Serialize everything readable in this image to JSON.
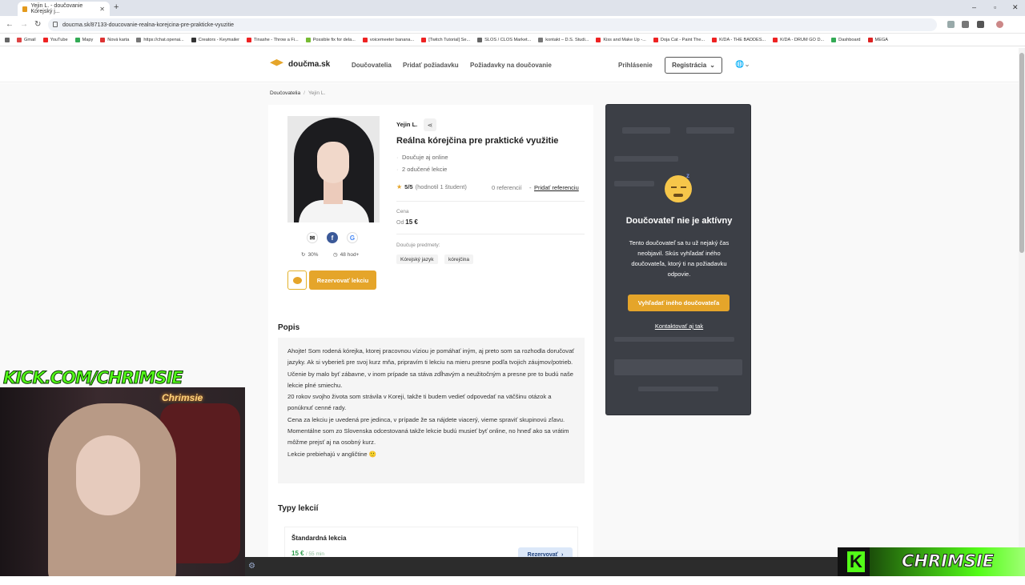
{
  "browser": {
    "tab_title": "Yejin L. - doučovanie Kórejský j...",
    "url": "doucma.sk/87133-doucovanie-realna-korejcina-pre-prakticke-vyuzitie",
    "bookmarks": [
      "Gmail",
      "YouTube",
      "Mapy",
      "Nová karta",
      "https://chat.openai...",
      "Creators - Keymailer",
      "Tinashe - Throw a Fi...",
      "Possible fix for dela...",
      "voicemeeter banana...",
      "[Twitch Tutorial] Se...",
      "SLOS / CLOS Market...",
      "kontakt – D.S. Studi...",
      "Kiss and Make Up -...",
      "Doja Cat - Paint The...",
      "K/DA - THE BADDES...",
      "K/DA - DRUM GO D...",
      "Dashboard",
      "MEGA"
    ]
  },
  "site": {
    "logo": "doučma.sk",
    "nav": [
      "Doučovatelia",
      "Pridať požiadavku",
      "Požiadavky na doučovanie"
    ],
    "login": "Prihlásenie",
    "register": "Registrácia",
    "register_caret": "⌄",
    "globe": "🌐⌄"
  },
  "breadcrumb": {
    "root": "Doučovatelia",
    "current": "Yejin L."
  },
  "tutor": {
    "name": "Yejin L.",
    "title": "Reálna kórejčina pre praktické využitie",
    "online": "Doučuje aj online",
    "taught": "2 odučené lekcie",
    "rating": "5/5",
    "rating_note": "(hodnotil 1 študent)",
    "refs": "0 referencií",
    "add_ref": "Pridať referenciu",
    "price_label": "Cena",
    "price_prefix": "Od",
    "price": "15 €",
    "subjects_label": "Doučuje predmety:",
    "subjects": [
      "Kórejský jazyk",
      "kórejčina"
    ],
    "response_rate": "30%",
    "response_time": "48 hod+",
    "book_label": "Rezervovať lekciu"
  },
  "description": {
    "title": "Popis",
    "paragraphs": [
      "Ahojte! Som rodená kórejka, ktorej pracovnou víziou je pomáhať iným, aj preto som sa rozhodla doručovať jazyky. Ak si vyberieš pre svoj kurz mňa, pripravím ti lekciu na mieru presne podľa tvojich záujmov/potrieb. Učenie by malo byť zábavne, v inom prípade sa stáva zdĺhavým a neužitočným a presne pre to budú naše lekcie plné smiechu.",
      "20 rokov svojho života som strávila v Koreji, takže ti budem vedieť odpovedať na väčšinu otázok a ponúknuť cenné rady.",
      "Cena za lekciu je uvedená pre jedinca, v prípade že sa nájdete viacerý, vieme spraviť skupinovú zľavu.",
      "Momentálne som zo Slovenska odcestovaná takže lekcie budú musieť byť online, no hneď ako sa vrátim môžme prejsť aj na osobný kurz.",
      "Lekcie prebiehajú v angličtine 🙂"
    ]
  },
  "lessons": {
    "title": "Typy lekcií",
    "items": [
      {
        "name": "Štandardná lekcia",
        "price": "15 €",
        "duration": "/ 55 min",
        "book": "Rezervovať"
      }
    ]
  },
  "inactive": {
    "heading": "Doučovateľ nie je aktívny",
    "text": "Tento doučovateľ sa tu už nejaký čas neobjavil. Skús vyhľadať iného doučovateľa, ktorý ti na požiadavku odpovie.",
    "search_btn": "Vyhľadať iného doučovateľa",
    "contact": "Kontaktovať aj tak"
  },
  "stream": {
    "kick_url": "KICK.COM/CHRIMSIE",
    "neon": "Chrimsie",
    "brand": "CHRIMSIE",
    "brand_k": "K"
  },
  "colors": {
    "accent": "#e5a52a",
    "dark_panel": "#3c3f46",
    "kick_green": "#53fc18"
  }
}
